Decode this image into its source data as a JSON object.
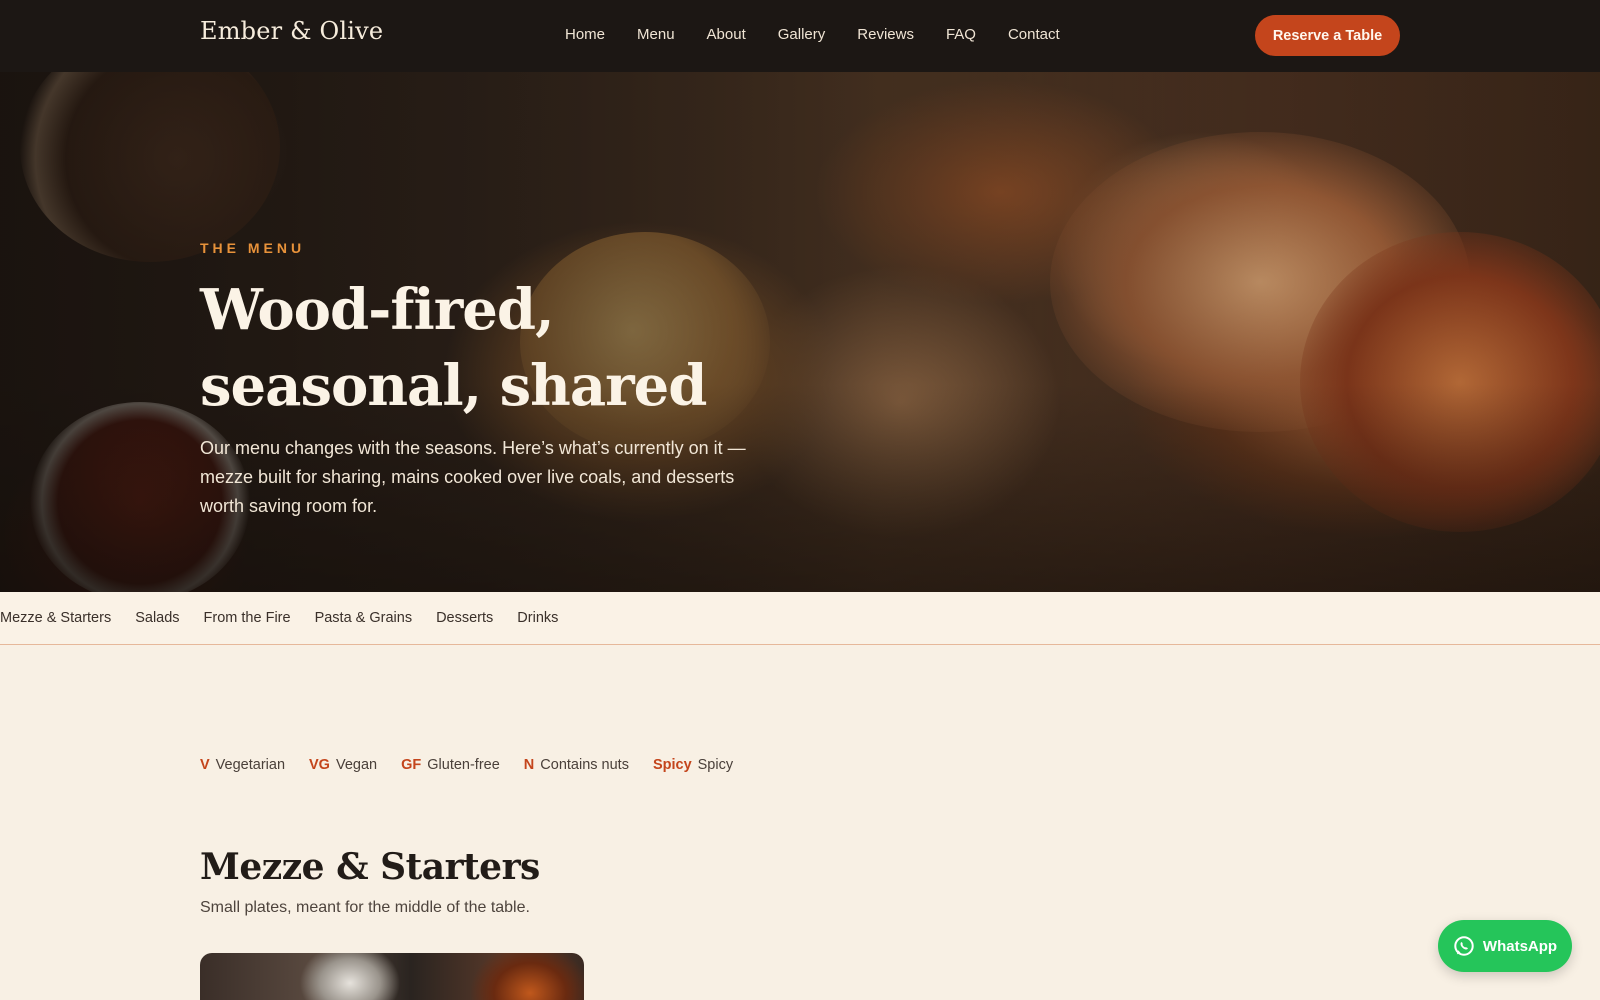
{
  "header": {
    "brand": "Ember & Olive",
    "nav": [
      "Home",
      "Menu",
      "About",
      "Gallery",
      "Reviews",
      "FAQ",
      "Contact"
    ],
    "cta": "Reserve a Table"
  },
  "hero": {
    "eyebrow": "THE MENU",
    "title": "Wood-fired, seasonal, shared",
    "text": "Our menu changes with the seasons. Here’s what’s currently on it — mezze built for sharing, mains cooked over live coals, and desserts worth saving room for."
  },
  "categories": [
    "Mezze & Starters",
    "Salads",
    "From the Fire",
    "Pasta & Grains",
    "Desserts",
    "Drinks"
  ],
  "legend": [
    {
      "code": "V",
      "label": "Vegetarian"
    },
    {
      "code": "VG",
      "label": "Vegan"
    },
    {
      "code": "GF",
      "label": "Gluten-free"
    },
    {
      "code": "N",
      "label": "Contains nuts"
    },
    {
      "code": "Spicy",
      "label": "Spicy"
    }
  ],
  "section": {
    "title": "Mezze & Starters",
    "subtitle": "Small plates, meant for the middle of the table."
  },
  "whatsapp": {
    "label": "WhatsApp",
    "icon": "whatsapp-icon"
  },
  "colors": {
    "accent": "#c4451c",
    "header_bg": "#1c1714",
    "page_bg": "#f8f0e4",
    "eyebrow": "#e8923a",
    "whatsapp": "#25c55a"
  }
}
